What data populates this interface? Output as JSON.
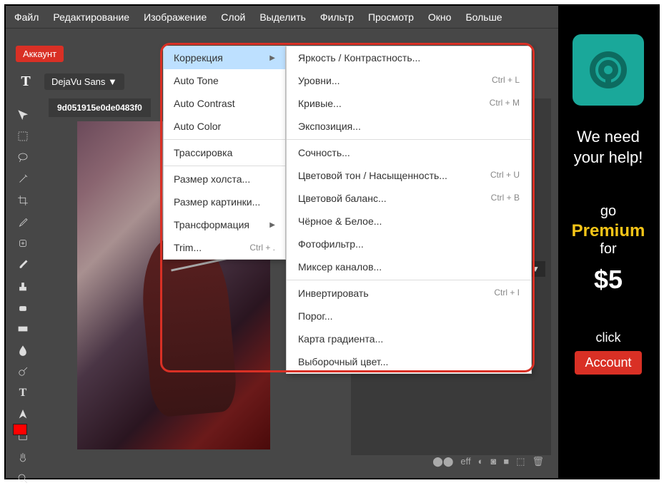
{
  "menubar": {
    "items": [
      "Файл",
      "Редактирование",
      "Изображение",
      "Слой",
      "Выделить",
      "Фильтр",
      "Просмотр",
      "Окно",
      "Больше"
    ]
  },
  "account_btn": "Аккаунт",
  "font": {
    "icon": "T",
    "name": "DejaVu Sans ▼"
  },
  "tab": "9d051915e0de0483f0",
  "percent": "% ▼",
  "dropdown": {
    "correction": {
      "label": "Коррекция"
    },
    "auto_tone": "Auto Tone",
    "auto_contrast": "Auto Contrast",
    "auto_color": "Auto Color",
    "tracing": "Трассировка",
    "canvas_size": "Размер холста...",
    "image_size": "Размер картинки...",
    "transform": {
      "label": "Трансформация"
    },
    "trim": {
      "label": "Trim...",
      "shortcut": "Ctrl + ."
    }
  },
  "submenu": {
    "brightness": "Яркость / Контрастность...",
    "levels": {
      "label": "Уровни...",
      "shortcut": "Ctrl + L"
    },
    "curves": {
      "label": "Кривые...",
      "shortcut": "Ctrl + M"
    },
    "exposure": "Экспозиция...",
    "vibrance": "Сочность...",
    "hue_sat": {
      "label": "Цветовой тон / Насыщенность...",
      "shortcut": "Ctrl + U"
    },
    "color_balance": {
      "label": "Цветовой баланс...",
      "shortcut": "Ctrl + B"
    },
    "bw": "Чёрное & Белое...",
    "photo_filter": "Фотофильтр...",
    "channel_mixer": "Миксер каналов...",
    "invert": {
      "label": "Инвертировать",
      "shortcut": "Ctrl + I"
    },
    "threshold": "Порог...",
    "gradient_map": "Карта градиента...",
    "selective_color": "Выборочный цвет..."
  },
  "ad": {
    "line1": "We need your help!",
    "go": "go",
    "premium": "Premium",
    "for": "for",
    "price": "$5",
    "click": "click",
    "account": "Account"
  },
  "bottom_icons": [
    "⬤⬤",
    "eff",
    "◐",
    "◙",
    "■",
    "⬚",
    "🗑"
  ]
}
